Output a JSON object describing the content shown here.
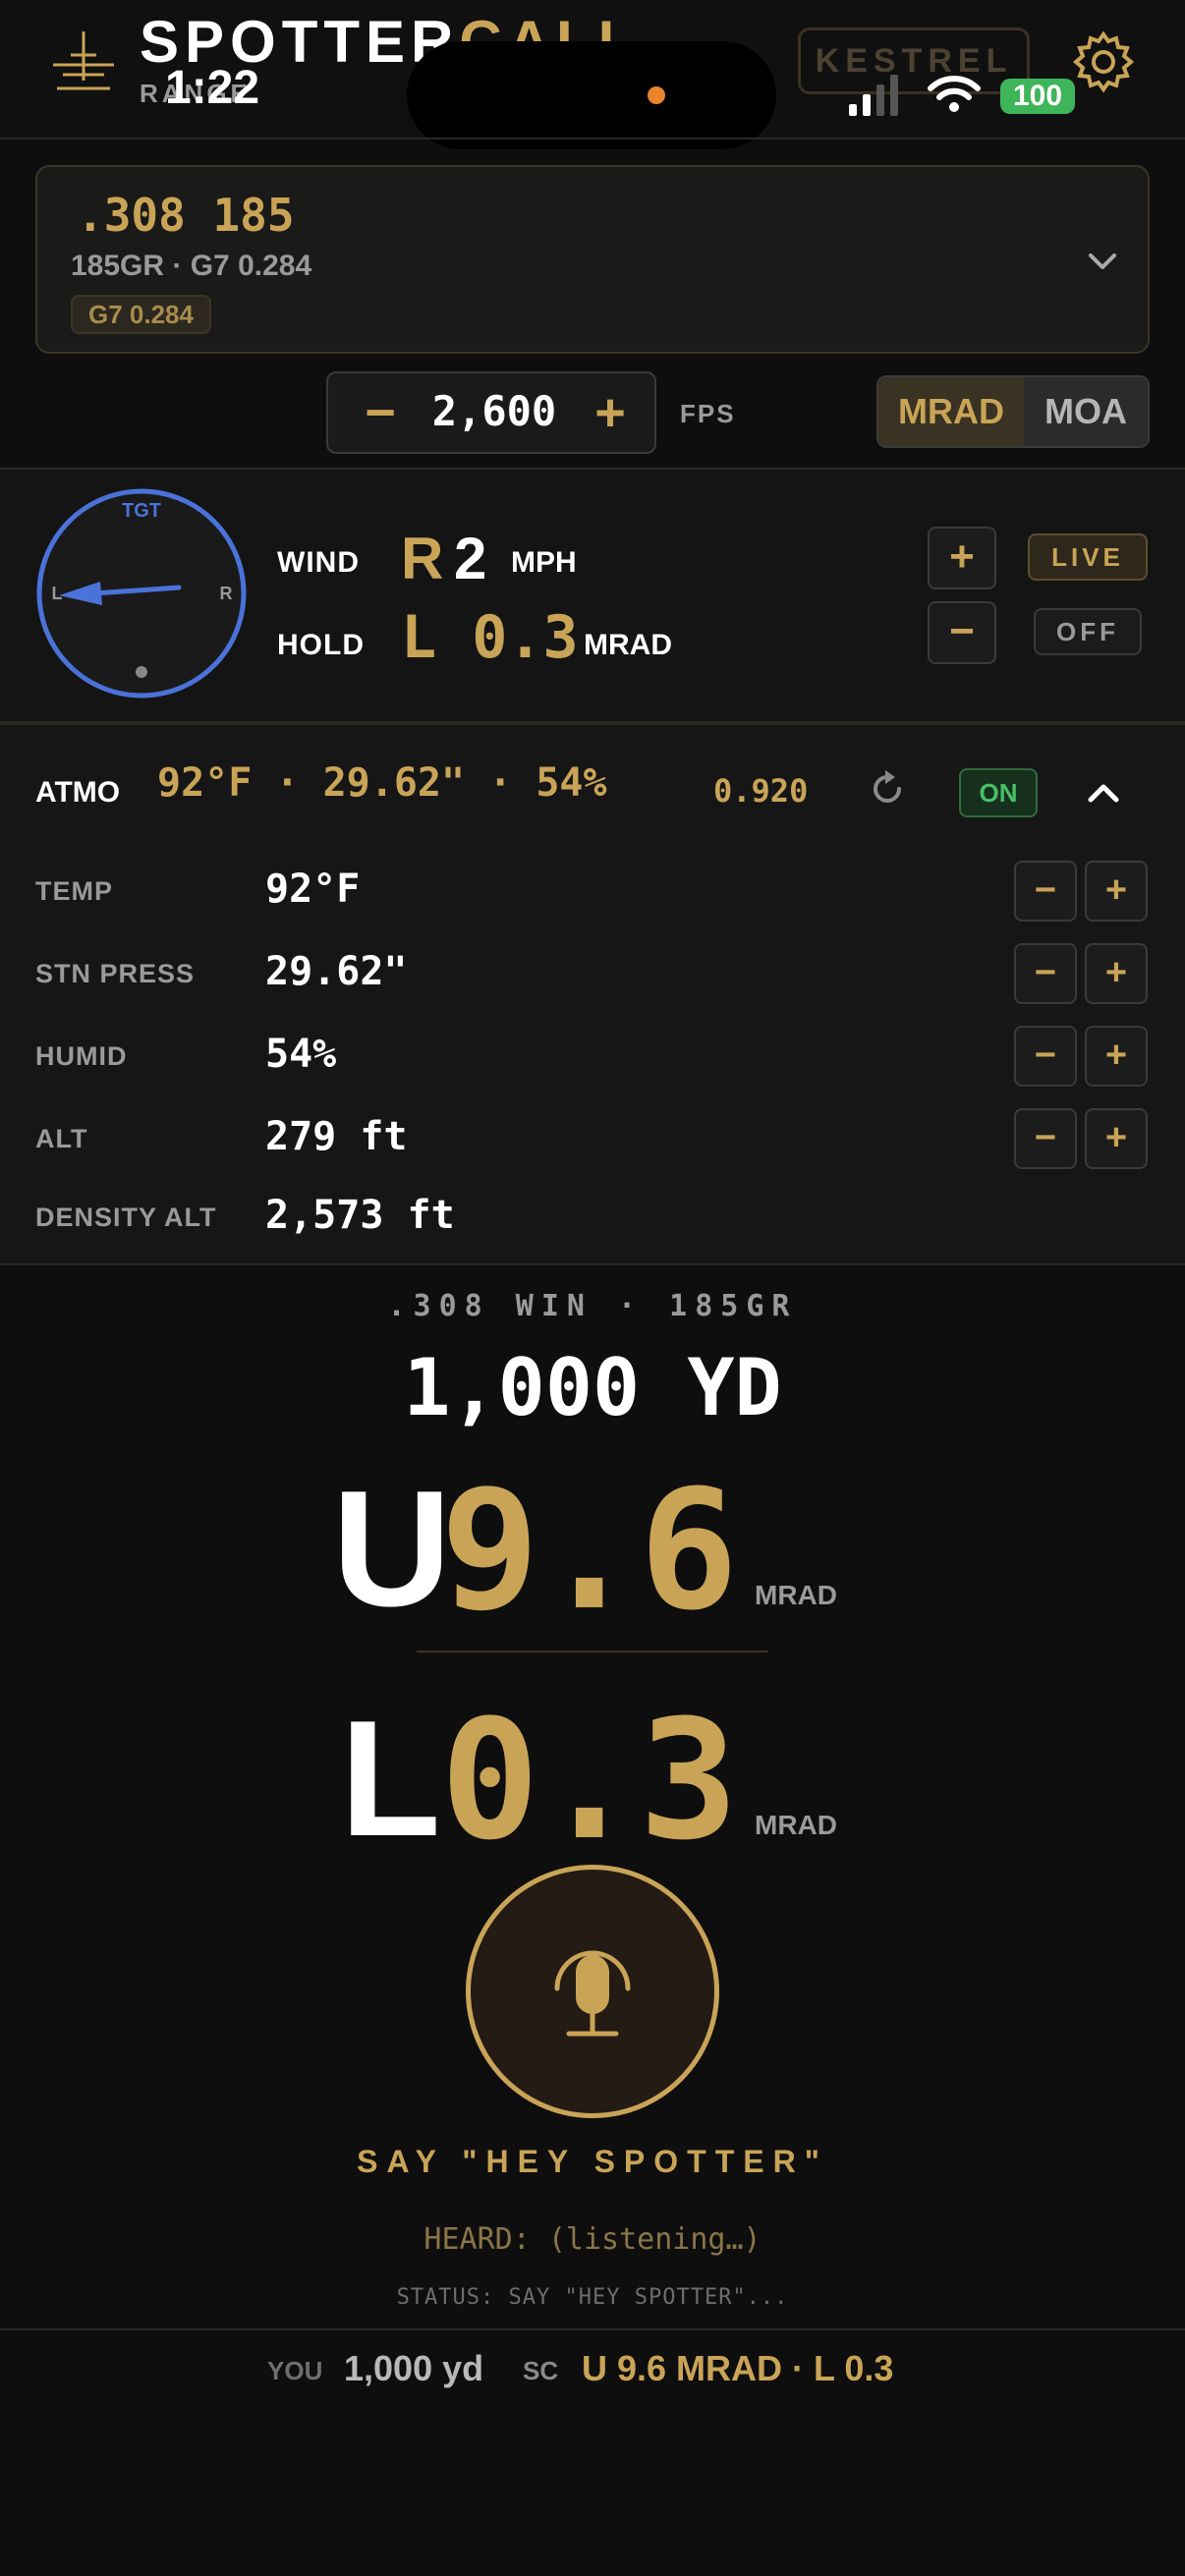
{
  "header": {
    "app_title_main": "SPOTTER",
    "app_title_accent": "CALL",
    "app_subtitle": "RANGE",
    "clock": "1:22",
    "kestrel_label": "KESTREL",
    "battery": "100",
    "settings_icon": "gear-icon",
    "logo_icon": "crosshair-icon"
  },
  "ammo": {
    "name": ".308 185",
    "detail": "185GR · G7 0.284",
    "badge": "G7 0.284",
    "chevron_icon": "chevron-down-icon"
  },
  "velocity": {
    "minus": "−",
    "value": "2,600",
    "plus": "+",
    "unit": "FPS"
  },
  "units": {
    "mrad": "MRAD",
    "moa": "MOA",
    "selected": "MRAD"
  },
  "wind": {
    "compass_target": "TGT",
    "compass_left": "L",
    "compass_right": "R",
    "wind_label": "WIND",
    "direction": "R",
    "speed": "2",
    "speed_unit": "MPH",
    "hold_label": "HOLD",
    "hold_value": "L 0.3",
    "hold_unit": "MRAD",
    "plus": "+",
    "minus": "−",
    "live": "LIVE",
    "off": "OFF"
  },
  "atmo": {
    "label": "ATMO",
    "summary": "92°F · 29.62\" · 54%",
    "bc": "0.920",
    "on": "ON",
    "rows": [
      {
        "label": "TEMP",
        "value": "92°F",
        "minus": "−",
        "plus": "+"
      },
      {
        "label": "STN PRESS",
        "value": "29.62\"",
        "minus": "−",
        "plus": "+"
      },
      {
        "label": "HUMID",
        "value": "54%",
        "minus": "−",
        "plus": "+"
      },
      {
        "label": "ALT",
        "value": "279 ft",
        "minus": "−",
        "plus": "+"
      }
    ],
    "density_alt_label": "DENSITY ALT",
    "density_alt_value": "2,573 ft"
  },
  "dope": {
    "ammo_line": ".308 WIN · 185GR",
    "range": "1,000 YD",
    "elev_dir": "U",
    "elev_value": "9.6",
    "elev_unit": "MRAD",
    "wind_dir": "L",
    "wind_value": "0.3",
    "wind_unit": "MRAD"
  },
  "voice": {
    "mic_icon": "microphone-icon",
    "hint": "SAY \"HEY SPOTTER\"",
    "heard": "HEARD: (listening…)",
    "status": "STATUS: SAY \"HEY SPOTTER\"..."
  },
  "footer": {
    "you_label": "YOU",
    "you_value": "1,000 yd",
    "sc_label": "SC",
    "sc_value": "U 9.6 MRAD · L 0.3"
  },
  "colors": {
    "accent": "#c9a457",
    "background": "#0e0e0e",
    "compass": "#4a72d9",
    "live_green": "#46c068"
  }
}
